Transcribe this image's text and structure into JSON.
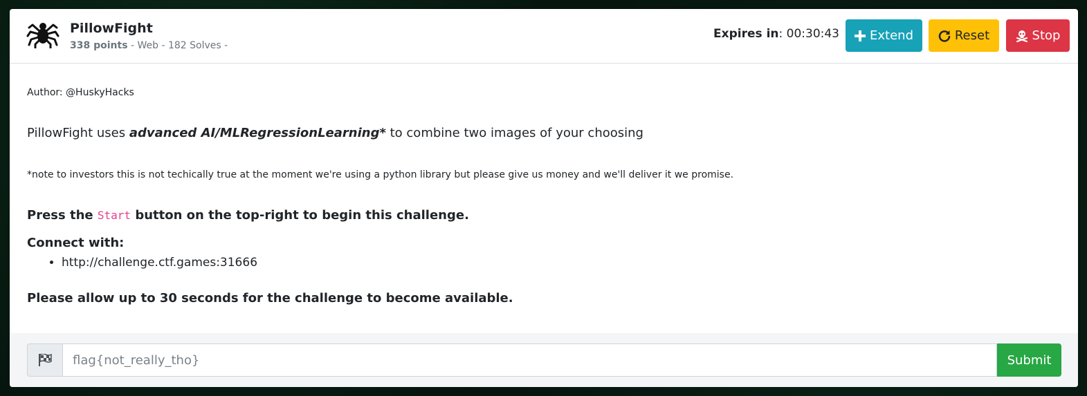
{
  "challenge": {
    "title": "PillowFight",
    "points": "338 points",
    "meta_rest": " - Web - 182 Solves -",
    "icon": "spider-icon"
  },
  "timer": {
    "label": "Expires in",
    "value": ": 00:30:43"
  },
  "actions": {
    "extend_label": "Extend",
    "reset_label": "Reset",
    "stop_label": "Stop"
  },
  "description": {
    "author": "Author: @HuskyHacks",
    "intro_pre": "PillowFight uses ",
    "intro_emph": "advanced AI/MLRegressionLearning*",
    "intro_post": " to combine two images of your choosing",
    "note": "*note to investors this is not techically true at the moment we're using a python library but please give us money and we'll deliver it we promise.",
    "press_pre": "Press the ",
    "press_code": "Start",
    "press_post": " button on the top-right to begin this challenge.",
    "connect_label": "Connect with:",
    "connect_url": "http://challenge.ctf.games:31666",
    "allow": "Please allow up to 30 seconds for the challenge to become available."
  },
  "submission": {
    "placeholder": "flag{not_really_tho}",
    "submit_label": "Submit"
  },
  "colors": {
    "extend": "#17a2b8",
    "reset": "#ffc107",
    "stop": "#dc3545",
    "submit": "#28a745",
    "code": "#e83e8c"
  }
}
